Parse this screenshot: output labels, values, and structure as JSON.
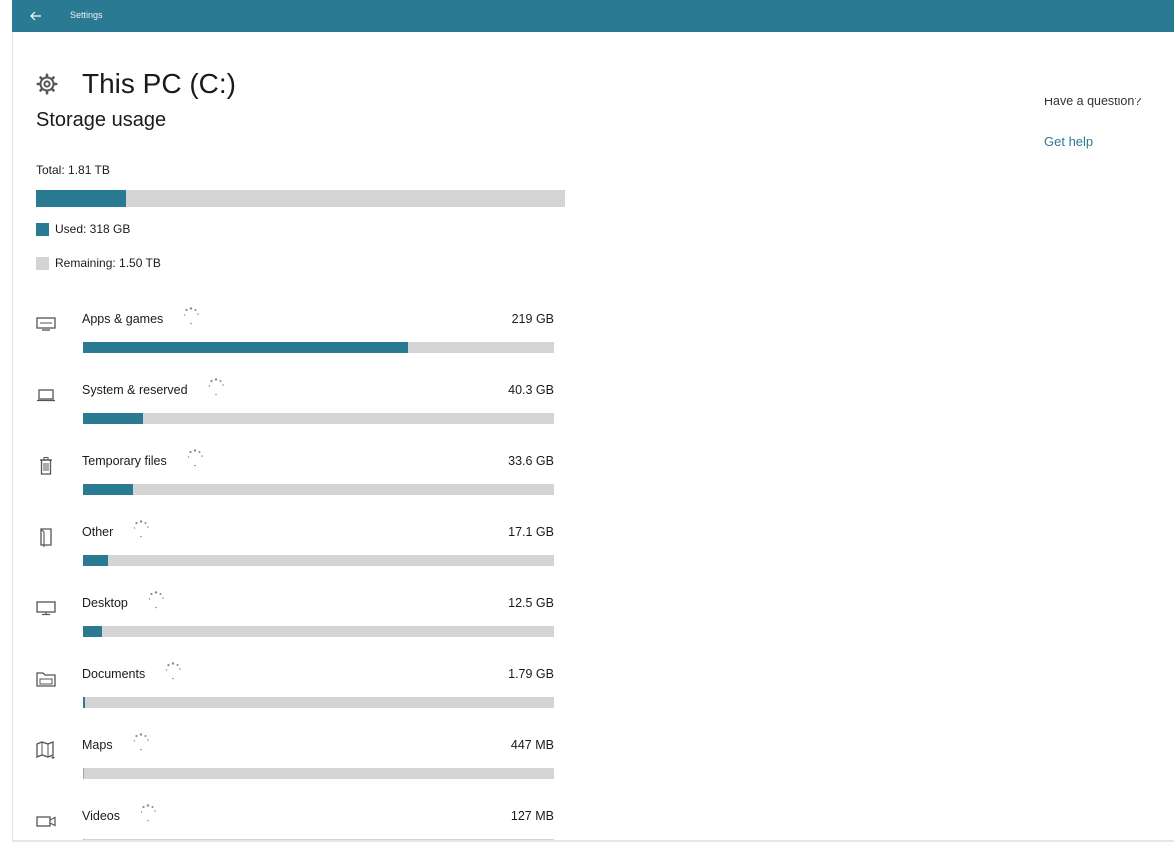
{
  "window": {
    "title": "Settings"
  },
  "header": {
    "title": "This PC (C:)",
    "icon": "gear-icon"
  },
  "storage": {
    "section_title": "Storage usage",
    "total_label": "Total: 1.81 TB",
    "used_fraction": 0.17,
    "used_label": "Used: 318 GB",
    "remaining_label": "Remaining: 1.50 TB"
  },
  "categories": [
    {
      "label": "Apps & games",
      "size": "219 GB",
      "fraction": 0.69,
      "icon": "monitor-keyboard-icon"
    },
    {
      "label": "System & reserved",
      "size": "40.3 GB",
      "fraction": 0.127,
      "icon": "laptop-icon"
    },
    {
      "label": "Temporary files",
      "size": "33.6 GB",
      "fraction": 0.107,
      "icon": "trash-icon"
    },
    {
      "label": "Other",
      "size": "17.1 GB",
      "fraction": 0.053,
      "icon": "book-icon"
    },
    {
      "label": "Desktop",
      "size": "12.5 GB",
      "fraction": 0.04,
      "icon": "monitor-icon"
    },
    {
      "label": "Documents",
      "size": "1.79 GB",
      "fraction": 0.005,
      "icon": "folder-icon"
    },
    {
      "label": "Maps",
      "size": "447 MB",
      "fraction": 0.0,
      "icon": "map-icon"
    },
    {
      "label": "Videos",
      "size": "127 MB",
      "fraction": 0.0,
      "icon": "video-icon"
    }
  ],
  "help": {
    "question": "Have a question?",
    "link": "Get help"
  },
  "colors": {
    "accent": "#2b7a94",
    "bar_track": "#d4d4d4",
    "text": "#1a1a1a"
  }
}
